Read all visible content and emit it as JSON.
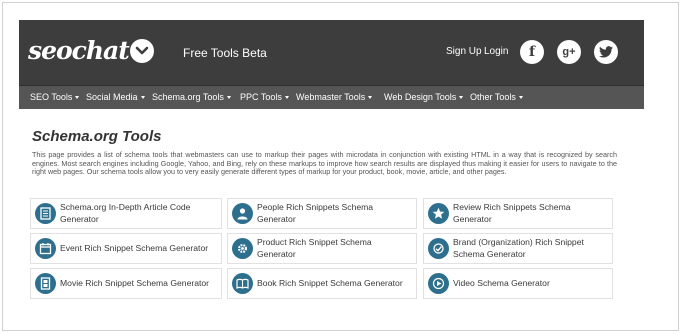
{
  "header": {
    "logo_text": "seochat",
    "tagline": "Free Tools Beta",
    "signup_label": "Sign Up",
    "login_label": "Login",
    "social": {
      "facebook": "f",
      "googleplus": "g+"
    }
  },
  "nav": [
    {
      "label": "SEO Tools"
    },
    {
      "label": "Social Media"
    },
    {
      "label": "Schema.org Tools"
    },
    {
      "label": "PPC Tools"
    },
    {
      "label": "Webmaster Tools"
    },
    {
      "label": "Web Design Tools"
    },
    {
      "label": "Other Tools"
    }
  ],
  "main": {
    "title": "Schema.org Tools",
    "intro": "This page provides a list of schema tools that webmasters can use to markup their pages with microdata in conjunction with existing HTML in a way that is recognized by search engines. Most search engines including Google, Yahoo, and Bing, rely on these markups to improve how search results are displayed thus making it easier for users to navigate to the right web pages. Our schema tools allow you to very easily generate different types of markup for your product, book, movie, article, and other pages.",
    "tools": [
      {
        "label": "Schema.org In-Depth Article Code Generator",
        "icon": "article-icon"
      },
      {
        "label": "People Rich Snippets Schema Generator",
        "icon": "person-icon"
      },
      {
        "label": "Review Rich Snippets Schema Generator",
        "icon": "review-star-icon"
      },
      {
        "label": "Event Rich Snippet Schema Generator",
        "icon": "calendar-icon"
      },
      {
        "label": "Product Rich Snippet Schema Generator",
        "icon": "gear-icon"
      },
      {
        "label": "Brand (Organization) Rich Snippet Schema Generator",
        "icon": "brand-icon"
      },
      {
        "label": "Movie Rich Snippet Schema Generator",
        "icon": "film-icon"
      },
      {
        "label": "Book Rich Snippet Schema Generator",
        "icon": "book-icon"
      },
      {
        "label": "Video Schema Generator",
        "icon": "video-icon"
      }
    ]
  },
  "colors": {
    "header_bg": "#3d3d3d",
    "nav_bg": "#555555",
    "icon_bg": "#2e6f8e"
  }
}
